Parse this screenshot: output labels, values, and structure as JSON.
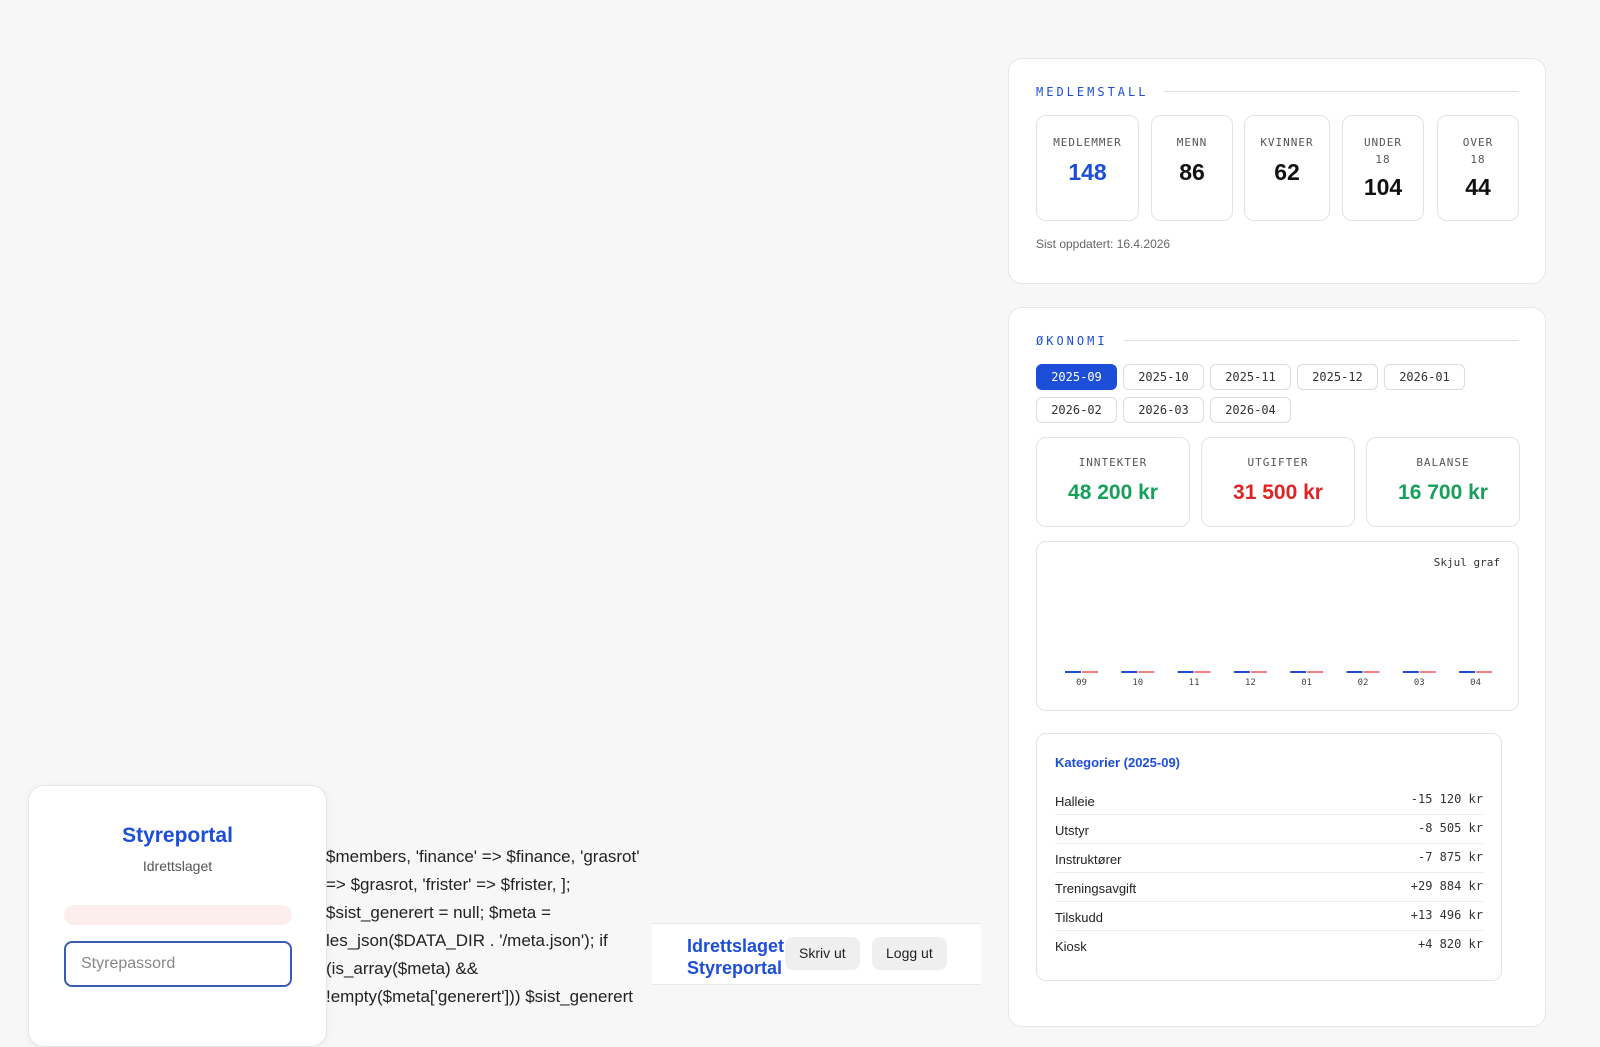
{
  "login": {
    "title": "Styreportal",
    "subtitle": "Idrettslaget",
    "password_placeholder": "Styrepassord"
  },
  "code_leak": "$members, 'finance' => $finance, 'grasrot' => $grasrot, 'frister' => $frister, ]; $sist_generert = null; $meta = les_json($DATA_DIR . '/meta.json'); if (is_array($meta) && !empty($meta['generert'])) $sist_generert",
  "header": {
    "brand_line1": "Idrettslaget",
    "brand_line2": "Styreportal",
    "print_label": "Skriv ut",
    "logout_label": "Logg ut"
  },
  "members": {
    "section_title": "MEDLEMSTALL",
    "stats": [
      {
        "label": "MEDLEMMER",
        "value": "148"
      },
      {
        "label": "MENN",
        "value": "86"
      },
      {
        "label": "KVINNER",
        "value": "62"
      },
      {
        "label": "UNDER 18",
        "value": "104"
      },
      {
        "label": "OVER 18",
        "value": "44"
      }
    ],
    "updated": "Sist oppdatert: 16.4.2026"
  },
  "economy": {
    "section_title": "ØKONOMI",
    "months": [
      "2025-09",
      "2025-10",
      "2025-11",
      "2025-12",
      "2026-01",
      "2026-02",
      "2026-03",
      "2026-04"
    ],
    "selected_month": "2025-09",
    "summary": [
      {
        "label": "INNTEKTER",
        "value": "48 200 kr",
        "color": "#16a05a"
      },
      {
        "label": "UTGIFTER",
        "value": "31 500 kr",
        "color": "#dc2626"
      },
      {
        "label": "BALANSE",
        "value": "16 700 kr",
        "color": "#16a05a"
      }
    ],
    "hide_chart_label": "Skjul graf",
    "chart_colors": {
      "income": "#1d4ed8",
      "expense": "#f08080"
    },
    "categories_title": "Kategorier (2025-09)",
    "categories": [
      {
        "name": "Halleie",
        "amount": "-15 120 kr"
      },
      {
        "name": "Utstyr",
        "amount": "-8 505 kr"
      },
      {
        "name": "Instruktører",
        "amount": "-7 875 kr"
      },
      {
        "name": "Treningsavgift",
        "amount": "+29 884 kr"
      },
      {
        "name": "Tilskudd",
        "amount": "+13 496 kr"
      },
      {
        "name": "Kiosk",
        "amount": "+4 820 kr"
      }
    ]
  },
  "chart_data": {
    "type": "bar",
    "categories": [
      "09",
      "10",
      "11",
      "12",
      "01",
      "02",
      "03",
      "04"
    ],
    "series": [
      {
        "values": [
          0,
          0,
          0,
          0,
          0,
          0,
          0,
          0
        ]
      },
      {
        "values": [
          0,
          0,
          0,
          0,
          0,
          0,
          0,
          0
        ]
      }
    ]
  }
}
